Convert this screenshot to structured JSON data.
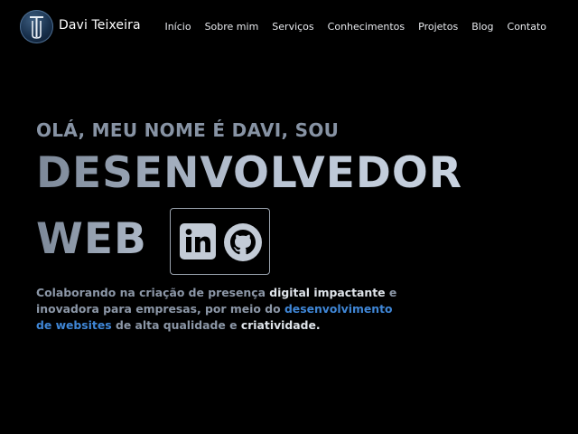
{
  "header": {
    "brand": "Davi Teixeira",
    "nav": [
      "Início",
      "Sobre mim",
      "Serviços",
      "Conhecimentos",
      "Projetos",
      "Blog",
      "Contato"
    ]
  },
  "hero": {
    "kicker": "OLÁ, MEU NOME É DAVI, SOU",
    "title_line1": "DESENVOLVEDOR",
    "title_line2": "WEB",
    "social": [
      "linkedin-icon",
      "github-icon"
    ],
    "description": {
      "part1": "Colaborando na criação de presença ",
      "part2": "digital impactante",
      "part3": " e inovadora para empresas, por meio do ",
      "part4": "desenvolvimento de websites",
      "part5": " de alta qualidade e ",
      "part6": "criatividade",
      "part7": "."
    }
  },
  "colors": {
    "background": "#000000",
    "accent": "#3f86d6",
    "muted_text": "#8c97a7"
  }
}
